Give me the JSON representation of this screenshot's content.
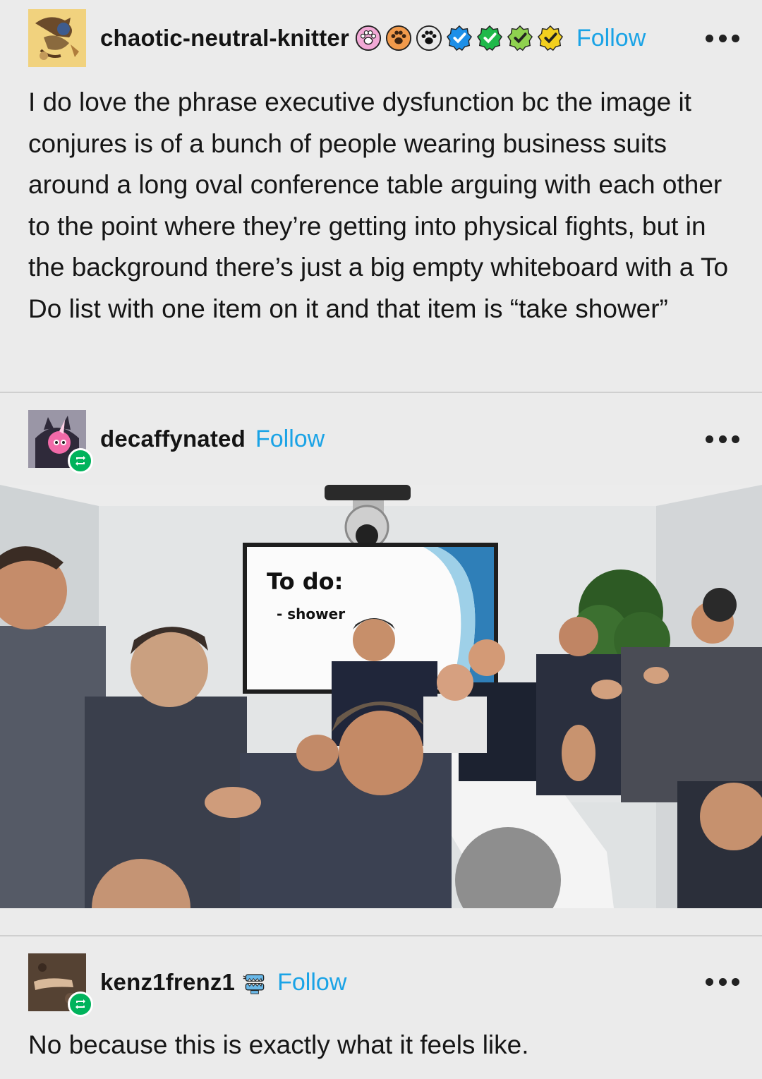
{
  "post1": {
    "username": "chaotic-neutral-knitter",
    "follow_label": "Follow",
    "badges": [
      "paw-badge-pink",
      "paw-badge-orange",
      "paw-badge-black",
      "check-badge-blue",
      "check-badge-green",
      "check-badge-lightgreen",
      "check-badge-yellow"
    ],
    "text": "I do love the phrase executive dysfunction bc the image it conjures is of a bunch of people wearing business suits around a long oval conference table arguing with each other to the point where they’re getting into physical fights, but in the background there’s just a big empty whiteboard with a To Do list with one item on it and that item is “take shower”"
  },
  "post2": {
    "username": "decaffynated",
    "follow_label": "Follow",
    "image": {
      "whiteboard_title": "To do:",
      "whiteboard_item": "- shower"
    }
  },
  "post3": {
    "username": "kenz1frenz1",
    "follow_label": "Follow",
    "text": "No because this is exactly what it feels like."
  },
  "colors": {
    "background": "#ebebeb",
    "follow_link": "#1aa3e6",
    "reblog_green": "#00b35c"
  }
}
